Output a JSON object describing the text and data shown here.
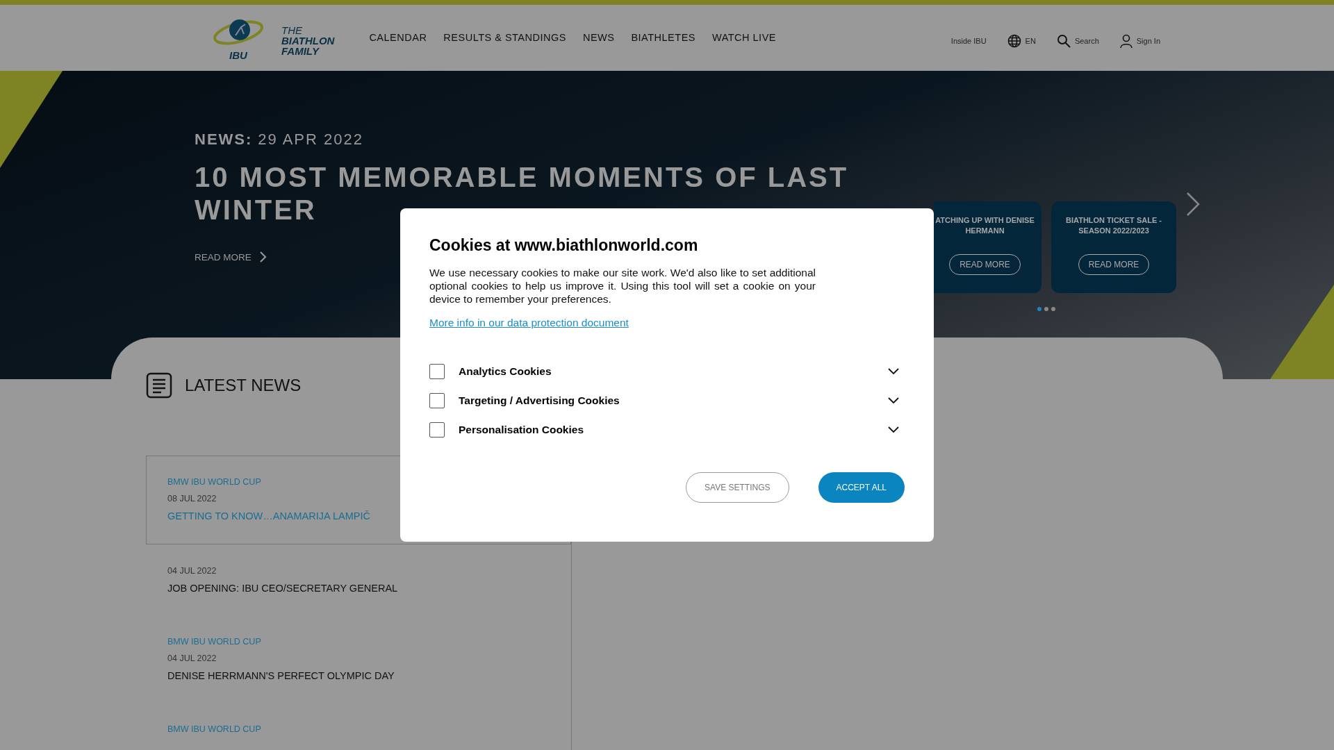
{
  "header": {
    "logo_text": "IBU",
    "tagline": [
      "THE",
      "BIATHLON",
      "FAMILY"
    ],
    "nav": [
      {
        "label": "CALENDAR"
      },
      {
        "label": "RESULTS & STANDINGS"
      },
      {
        "label": "NEWS"
      },
      {
        "label": "BIATHLETES"
      },
      {
        "label": "WATCH LIVE"
      }
    ],
    "utility": [
      {
        "kind": "text",
        "label": "Inside IBU"
      },
      {
        "kind": "language",
        "label": "EN"
      },
      {
        "kind": "search",
        "label": "Search"
      },
      {
        "kind": "user",
        "label": "Sign In"
      }
    ]
  },
  "hero": {
    "kicker": "NEWS:",
    "date": "29 APR 2022",
    "title": "10 MOST MEMORABLE MOMENTS OF LAST WINTER",
    "link": "READ MORE",
    "cards": [
      {
        "title": "ATCHING UP WITH DENISE HERMANN",
        "button": "READ MORE"
      },
      {
        "title": "BIATHLON TICKET SALE - SEASON 2022/2023",
        "button": "READ MORE"
      }
    ],
    "dots": [
      {
        "selected": true
      },
      {
        "selected": false
      },
      {
        "selected": false
      }
    ]
  },
  "latest_news": {
    "title": "LATEST NEWS",
    "items": [
      {
        "category": "BMW IBU WORLD CUP",
        "date": "08 JUL 2022",
        "headline": "GETTING TO KNOW…ANAMARIJA LAMPIČ",
        "selected": true
      },
      {
        "date": "04 JUL 2022",
        "headline": "JOB OPENING: IBU CEO/SECRETARY GENERAL",
        "selected": false
      },
      {
        "category": "BMW IBU WORLD CUP",
        "date": "04 JUL 2022",
        "headline": "DENISE HERRMANN'S PERFECT OLYMPIC DAY",
        "selected": false
      },
      {
        "category": "BMW IBU WORLD CUP",
        "selected": false
      }
    ]
  },
  "cookie_dialog": {
    "title": "Cookies at www.biathlonworld.com",
    "body": "We use necessary cookies to make our site work. We'd also like to set additional optional cookies to help us improve it. Using this tool will set a cookie on your device to remember your preferences.",
    "link": "More info in our data protection document",
    "categories": [
      {
        "label": "Analytics Cookies",
        "checked": false
      },
      {
        "label": "Targeting / Advertising Cookies",
        "checked": false
      },
      {
        "label": "Personalisation Cookies",
        "checked": false
      }
    ],
    "buttons": [
      {
        "kind": "secondary",
        "label": "SAVE SETTINGS"
      },
      {
        "kind": "primary",
        "label": "ACCEPT ALL"
      }
    ]
  }
}
